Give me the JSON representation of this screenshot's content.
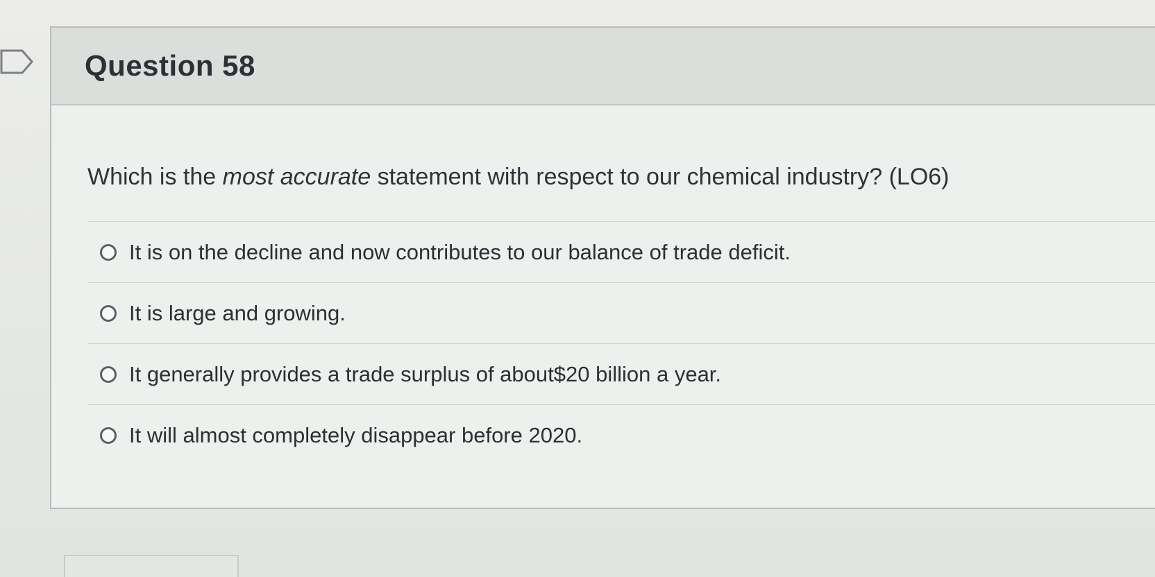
{
  "question": {
    "title": "Question 58",
    "text_part1": "Which is the ",
    "text_emphasis": "most accurate",
    "text_part2": " statement with respect to our chemical industry? (LO6)",
    "answers": [
      {
        "label": "It is on the decline and now contributes to our balance of trade deficit."
      },
      {
        "label": "It is large and growing."
      },
      {
        "label": "It generally provides a trade surplus of about$20 billion a year."
      },
      {
        "label": "It will almost completely disappear before 2020."
      }
    ]
  },
  "icons": {
    "flag": "flag-outline-icon",
    "radio": "radio-unchecked-icon"
  },
  "colors": {
    "header_bg": "#dcdedc",
    "body_bg": "#eef0ee",
    "text": "#2d3438"
  }
}
